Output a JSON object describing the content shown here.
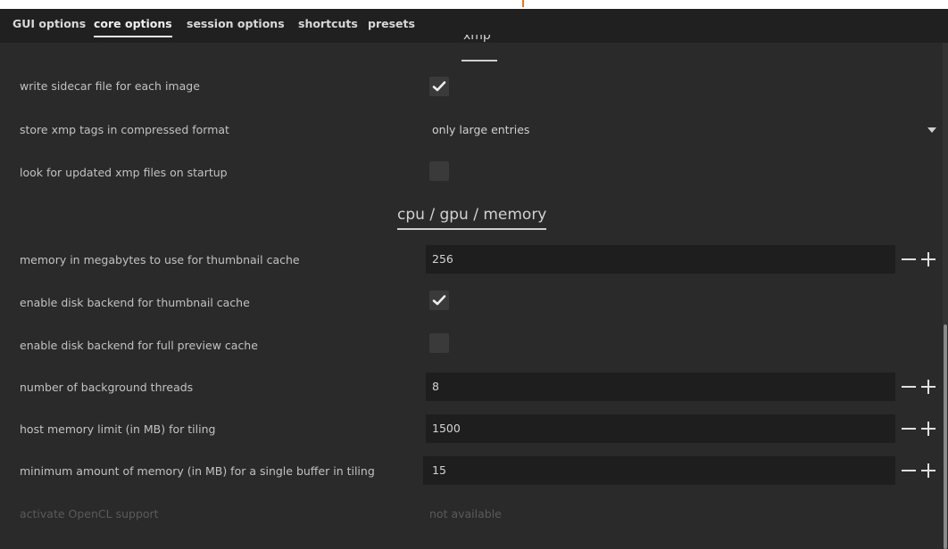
{
  "tabs": [
    {
      "label": "GUI options"
    },
    {
      "label": "core options"
    },
    {
      "label": "session options"
    },
    {
      "label": "shortcuts"
    },
    {
      "label": "presets"
    }
  ],
  "active_tab": "core options",
  "sections": {
    "xmp": {
      "title": "xmp"
    },
    "cpu": {
      "title": "cpu / gpu / memory"
    }
  },
  "rows": {
    "write_sidecar": {
      "label": "write sidecar file for each image",
      "checked": true
    },
    "compress_xmp": {
      "label": "store xmp tags in compressed format",
      "value": "only large entries"
    },
    "look_updated": {
      "label": "look for updated xmp files on startup",
      "checked": false
    },
    "thumb_mem": {
      "label": "memory in megabytes to use for thumbnail cache",
      "value": "256"
    },
    "disk_thumb": {
      "label": "enable disk backend for thumbnail cache",
      "checked": true
    },
    "disk_preview": {
      "label": "enable disk backend for full preview cache",
      "checked": false
    },
    "threads": {
      "label": "number of background threads",
      "value": "8"
    },
    "host_mem": {
      "label": "host memory limit (in MB) for tiling",
      "value": "1500"
    },
    "min_mem": {
      "label": "minimum amount of memory (in MB) for a single buffer in tiling",
      "value": "15"
    },
    "opencl": {
      "label": "activate OpenCL support",
      "value": "not available"
    }
  },
  "colors": {
    "background": "#2a2a2a",
    "tabbar": "#202020",
    "input": "#1e1e1e",
    "text": "#c2c2c2",
    "disabled": "#5a5a5a"
  }
}
